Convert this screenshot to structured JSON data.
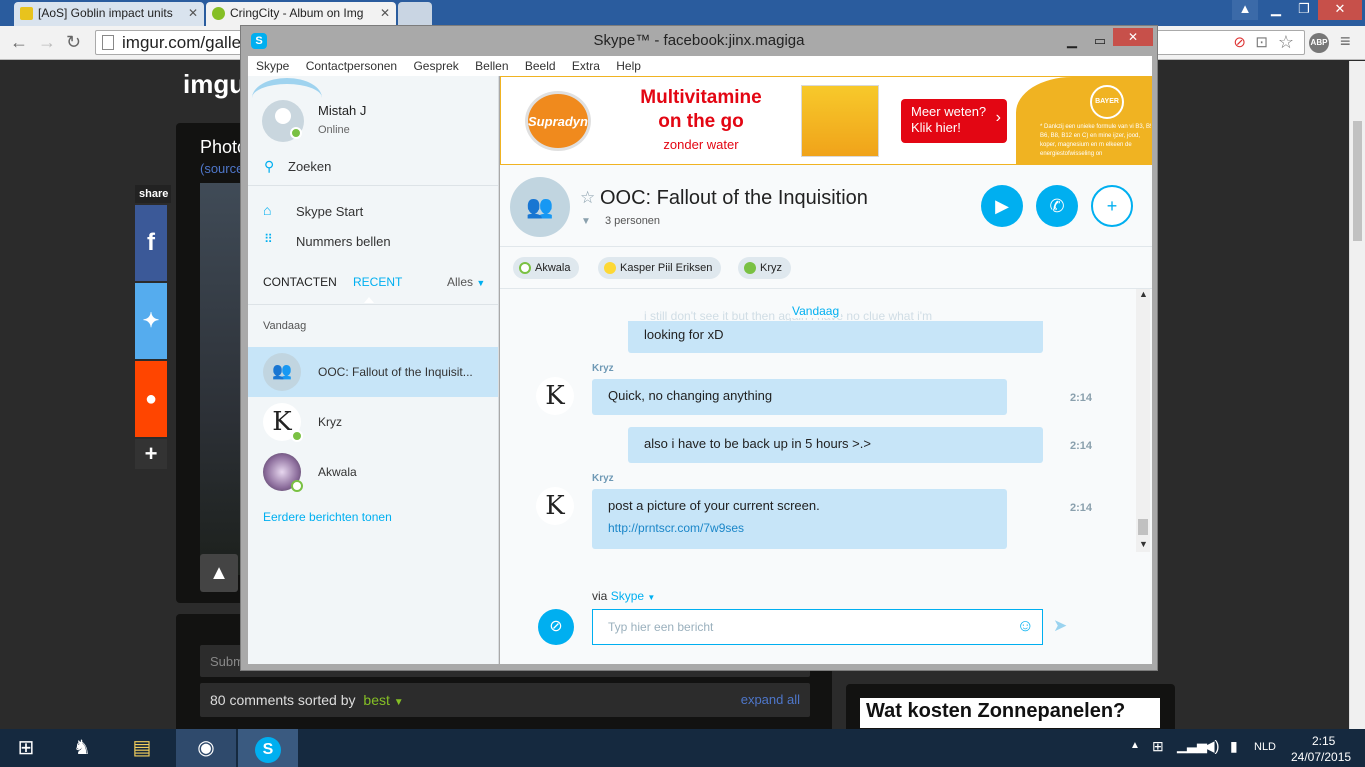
{
  "browser": {
    "tabs": [
      {
        "label": "[AoS] Goblin impact units"
      },
      {
        "label": "CringCity - Album on Img"
      }
    ],
    "url": "imgur.com/galler",
    "abp": "ABP"
  },
  "imgur": {
    "logo": "imgu",
    "photo_title": "Photo",
    "photo_source": "(source",
    "share_label": "share",
    "submit_placeholder": "Subm",
    "comments_count": "80 comments sorted by",
    "sort_value": "best",
    "expand_all": "expand all",
    "ad_text": "Wat kosten Zonnepanelen?"
  },
  "skype": {
    "window_title": "Skype™ - facebook:jinx.magiga",
    "menu": [
      "Skype",
      "Contactpersonen",
      "Gesprek",
      "Bellen",
      "Beeld",
      "Extra",
      "Help"
    ],
    "profile": {
      "name": "Mistah J",
      "status": "Online"
    },
    "search": "Zoeken",
    "nav": {
      "start": "Skype Start",
      "dial": "Nummers bellen"
    },
    "tabs": {
      "contacts": "CONTACTEN",
      "recent": "RECENT",
      "filter": "Alles"
    },
    "section": "Vandaag",
    "recent": [
      {
        "name": "OOC: Fallout of the Inquisit...",
        "selected": true
      },
      {
        "name": "Kryz"
      },
      {
        "name": "Akwala"
      }
    ],
    "earlier": "Eerdere berichten tonen",
    "ad": {
      "brand": "Supradyn",
      "headline1": "Multivitamine",
      "headline2": "on the go",
      "sub": "zonder water",
      "cta1": "Meer weten?",
      "cta2": "Klik hier!",
      "bayer": "BAYER",
      "fine": "* Dankzij een unieke formule van vi B3, B5, B6, B8, B12 en C) en mine ijzer, jood, koper, magnesium en m elkeen de energiestofwisseling on"
    },
    "convo": {
      "title": "OOC: Fallout of the Inquisition",
      "members": "3 personen"
    },
    "participants": [
      {
        "name": "Akwala",
        "color": "#ffffff"
      },
      {
        "name": "Kasper Piil Eriksen",
        "color": "#fdd835"
      },
      {
        "name": "Kryz",
        "color": "#7ac143"
      }
    ],
    "day_label": "Vandaag",
    "faded_text": "i still don't see it but then again i have no clue what i'm",
    "messages": [
      {
        "text": "looking for xD"
      },
      {
        "sender": "Kryz",
        "text": "Quick, no changing anything",
        "time": "2:14"
      },
      {
        "text": "also i have to be back up in 5 hours >.>",
        "time": "2:14"
      },
      {
        "sender": "Kryz",
        "text": "post a picture of your current screen.",
        "link": "http://prntscr.com/7w9ses",
        "time": "2:14"
      }
    ],
    "compose": {
      "via": "via",
      "network": "Skype",
      "placeholder": "Typ hier een bericht"
    }
  },
  "taskbar": {
    "lang": "NLD",
    "time": "2:15",
    "date": "24/07/2015"
  },
  "colors": {
    "skype_blue": "#00aff0",
    "chrome_tabbar": "#2a5c9e",
    "taskbar": "#15293f"
  }
}
